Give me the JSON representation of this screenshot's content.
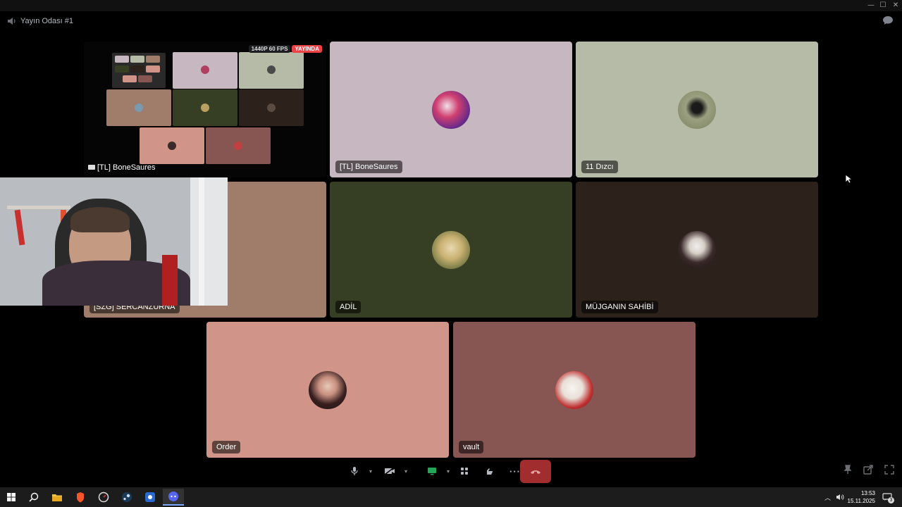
{
  "window": {
    "minimize": "—",
    "maximize": "☐",
    "close": "✕"
  },
  "channel": {
    "name": "Yayın Odası #1"
  },
  "stream": {
    "quality": "1440P 60 FPS",
    "live_badge": "YAYINDA",
    "streamer_label": "[TL] BoneSaures"
  },
  "participants": [
    {
      "id": "p1",
      "label": "[TL] BoneSaures",
      "bg": "#c7b7c1"
    },
    {
      "id": "p2",
      "label": "11 Dızcı",
      "bg": "#b5bba6"
    },
    {
      "id": "p3",
      "label": "[SZG] SERCANZURNA",
      "bg": "#a07c6b"
    },
    {
      "id": "p4",
      "label": "ADİL",
      "bg": "#363f23"
    },
    {
      "id": "p5",
      "label": "MÜJGANIN SAHİBİ",
      "bg": "#2c221b"
    },
    {
      "id": "p6",
      "label": "Order",
      "bg": "#d09488"
    },
    {
      "id": "p7",
      "label": "vault",
      "bg": "#875652"
    }
  ],
  "controls": {
    "mic": "microphone-icon",
    "camera": "camera-off-icon",
    "screen": "screen-share-icon",
    "activities": "activities-icon",
    "soundboard": "soundboard-icon",
    "more": "···",
    "leave": "disconnect-icon"
  },
  "taskbar": {
    "time": "13:53",
    "date": "15.11.2025",
    "notifications": "3"
  },
  "colors": {
    "accent_live": "#ed4245",
    "leave_red": "#a12d2f",
    "screen_share_green": "#23a55a"
  }
}
